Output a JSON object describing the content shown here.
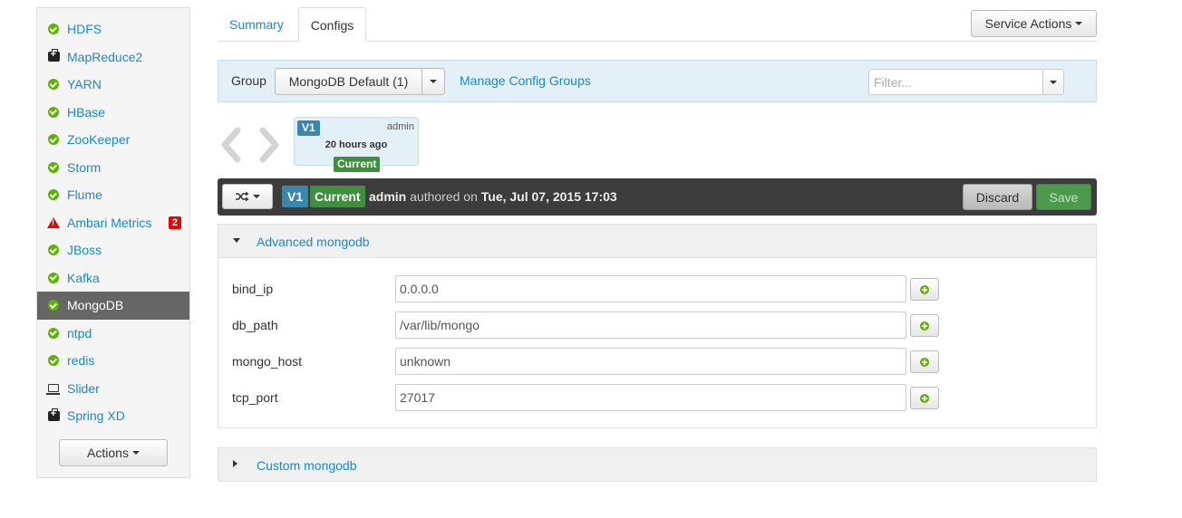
{
  "sidebar": {
    "services": [
      {
        "name": "HDFS",
        "icon": "check-circle-icon"
      },
      {
        "name": "MapReduce2",
        "icon": "medkit-icon"
      },
      {
        "name": "YARN",
        "icon": "check-circle-icon"
      },
      {
        "name": "HBase",
        "icon": "check-circle-icon"
      },
      {
        "name": "ZooKeeper",
        "icon": "check-circle-icon"
      },
      {
        "name": "Storm",
        "icon": "check-circle-icon"
      },
      {
        "name": "Flume",
        "icon": "check-circle-icon"
      },
      {
        "name": "Ambari Metrics",
        "icon": "warning-icon",
        "badge": "2"
      },
      {
        "name": "JBoss",
        "icon": "check-circle-icon"
      },
      {
        "name": "Kafka",
        "icon": "check-circle-icon"
      },
      {
        "name": "MongoDB",
        "icon": "check-circle-icon",
        "active": true
      },
      {
        "name": "ntpd",
        "icon": "check-circle-icon"
      },
      {
        "name": "redis",
        "icon": "check-circle-icon"
      },
      {
        "name": "Slider",
        "icon": "laptop-icon"
      },
      {
        "name": "Spring XD",
        "icon": "medkit-icon"
      }
    ],
    "actions_label": "Actions"
  },
  "tabs": {
    "summary": "Summary",
    "configs": "Configs",
    "service_actions": "Service Actions"
  },
  "group_bar": {
    "label": "Group",
    "selected": "MongoDB Default (1)",
    "manage_link": "Manage Config Groups",
    "filter_placeholder": "Filter..."
  },
  "version_card": {
    "version": "V1",
    "author": "admin",
    "time": "20 hours ago",
    "status": "Current"
  },
  "version_bar": {
    "version": "V1",
    "status": "Current",
    "author": "admin",
    "authored_text": "authored on",
    "date": "Tue, Jul 07, 2015 17:03",
    "discard_label": "Discard",
    "save_label": "Save"
  },
  "sections": {
    "advanced": {
      "title": "Advanced mongodb",
      "properties": [
        {
          "name": "bind_ip",
          "value": "0.0.0.0"
        },
        {
          "name": "db_path",
          "value": "/var/lib/mongo"
        },
        {
          "name": "mongo_host",
          "value": "unknown"
        },
        {
          "name": "tcp_port",
          "value": "27017"
        }
      ]
    },
    "custom": {
      "title": "Custom mongodb"
    }
  },
  "colors": {
    "link": "#1989c9",
    "ok_green": "#5ab400",
    "version_blue": "#3a87ad",
    "current_green": "#3f8f3f",
    "alert_red": "#e00000"
  }
}
